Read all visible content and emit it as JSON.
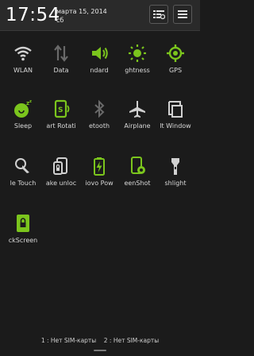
{
  "status": {
    "time": "17:54",
    "date": "марта 15, 2014",
    "weekday": "сб"
  },
  "colors": {
    "accent": "#7bc51d",
    "grey": "#d0d0d0",
    "muted": "#6a6a6a"
  },
  "header": {
    "settings_icon": "settings-list-icon",
    "menu_icon": "menu-icon"
  },
  "toggles": [
    {
      "label": "WLAN",
      "icon": "wifi-icon",
      "active": false
    },
    {
      "label": "Data",
      "icon": "data-arrows-icon",
      "active": false
    },
    {
      "label": "ndard",
      "icon": "sound-icon",
      "active": true
    },
    {
      "label": "ghtness",
      "icon": "brightness-icon",
      "active": true
    },
    {
      "label": "GPS",
      "icon": "gps-icon",
      "active": true
    },
    {
      "label": "Sleep",
      "icon": "sleep-icon",
      "active": true
    },
    {
      "label": "art Rotati",
      "icon": "smart-rotate-icon",
      "active": true
    },
    {
      "label": "etooth",
      "icon": "bluetooth-icon",
      "active": false
    },
    {
      "label": "Airplane",
      "icon": "airplane-icon",
      "active": false
    },
    {
      "label": "lt Window",
      "icon": "multi-window-icon",
      "active": false
    },
    {
      "label": "le Touch",
      "icon": "single-touch-icon",
      "active": false
    },
    {
      "label": "ake unloc",
      "icon": "shake-unlock-icon",
      "active": false
    },
    {
      "label": "iovo Pow",
      "icon": "power-saver-icon",
      "active": true
    },
    {
      "label": "eenShot",
      "icon": "screenshot-icon",
      "active": true
    },
    {
      "label": "shlight",
      "icon": "flashlight-icon",
      "active": false
    },
    {
      "label": "ckScreen",
      "icon": "lockscreen-icon",
      "active": true
    }
  ],
  "footer": {
    "sim1": "1 : Нет SIM-карты",
    "sim2": "2 : Нет SIM-карты"
  }
}
